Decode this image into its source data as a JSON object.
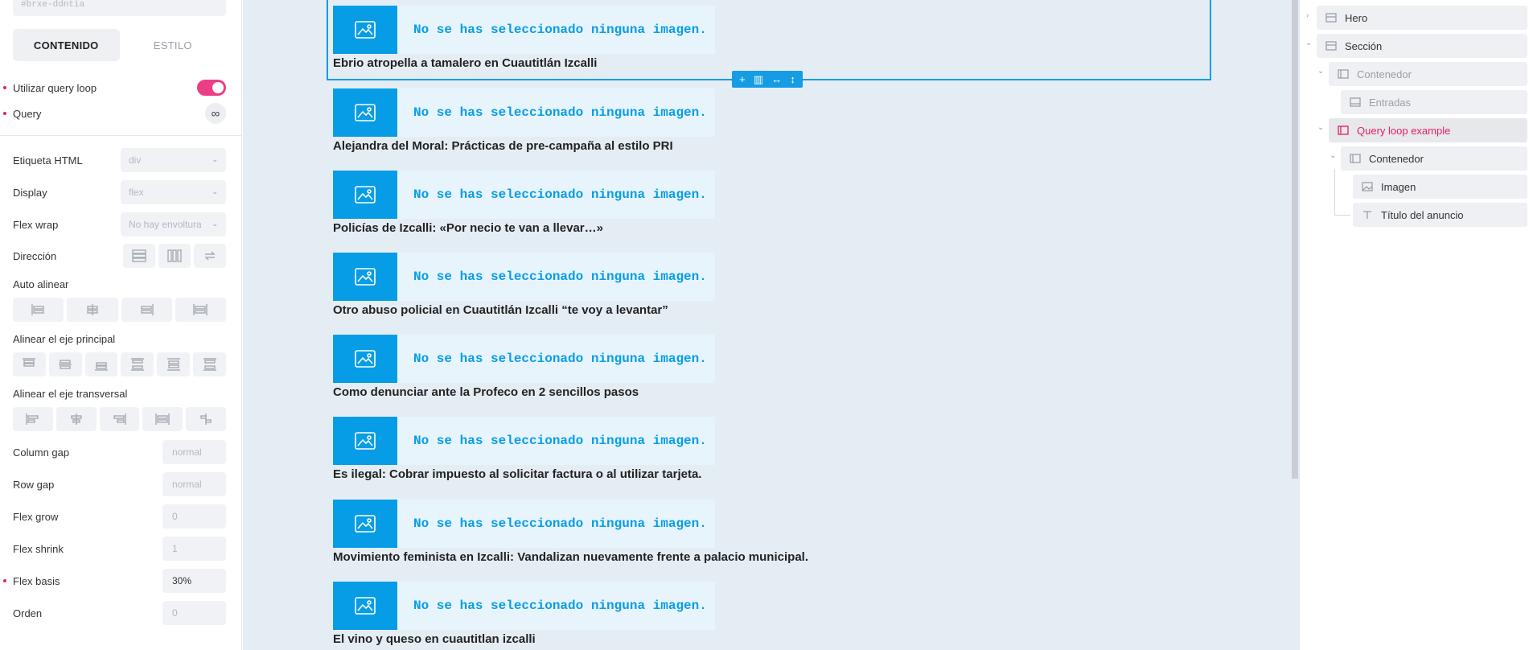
{
  "left_panel": {
    "class_input": "#brxe-ddntia",
    "tabs": {
      "content": "CONTENIDO",
      "style": "ESTILO"
    },
    "query_loop_label": "Utilizar query loop",
    "query_label": "Query",
    "query_icon": "∞",
    "html_tag": {
      "label": "Etiqueta HTML",
      "value": "div"
    },
    "display": {
      "label": "Display",
      "value": "flex"
    },
    "flex_wrap": {
      "label": "Flex wrap",
      "value": "No hay envoltura"
    },
    "direction_label": "Dirección",
    "auto_align_label": "Auto alinear",
    "main_axis_label": "Alinear el eje principal",
    "cross_axis_label": "Alinear el eje transversal",
    "column_gap": {
      "label": "Column gap",
      "value": "normal"
    },
    "row_gap": {
      "label": "Row gap",
      "value": "normal"
    },
    "flex_grow": {
      "label": "Flex grow",
      "value": "0"
    },
    "flex_shrink": {
      "label": "Flex shrink",
      "value": "1"
    },
    "flex_basis": {
      "label": "Flex basis",
      "value": "30%"
    },
    "order": {
      "label": "Orden",
      "value": "0"
    }
  },
  "canvas": {
    "placeholder_text": "No se has seleccionado ninguna imagen.",
    "items": [
      {
        "title": "Ebrio atropella a tamalero en Cuautitlán Izcalli"
      },
      {
        "title": "Alejandra del Moral: Prácticas de pre-campaña al estilo PRI"
      },
      {
        "title": "Policías de Izcalli: «Por necio te van a llevar…»"
      },
      {
        "title": "Otro abuso policial en Cuautitlán Izcalli “te voy a levantar”"
      },
      {
        "title": "Como denunciar ante la Profeco en 2 sencillos pasos"
      },
      {
        "title": "Es ilegal: Cobrar impuesto al solicitar factura o al utilizar tarjeta."
      },
      {
        "title": "Movimiento feminista en Izcalli: Vandalizan nuevamente frente a palacio municipal."
      },
      {
        "title": "El vino y queso en cuautitlan izcalli"
      }
    ],
    "toolbar": {
      "add": "+",
      "columns": "▥",
      "width": "↔",
      "height": "↕"
    }
  },
  "structure": {
    "hero": "Hero",
    "section": "Sección",
    "container1": "Contenedor",
    "entries": "Entradas",
    "query_loop": "Query loop example",
    "container2": "Contenedor",
    "image": "Imagen",
    "post_title": "Título del anuncio"
  },
  "colors": {
    "accent": "#079de6",
    "pink": "#ec3d85",
    "canvas_bg": "#e5edf4"
  }
}
